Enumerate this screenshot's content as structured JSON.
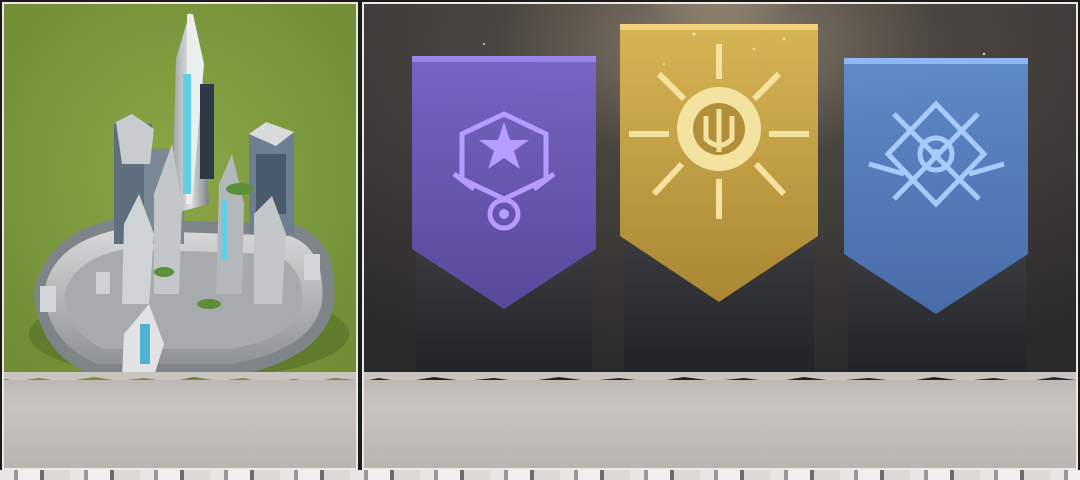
{
  "left_card": {
    "scene": "futuristic-citadel",
    "colors": {
      "grass": "#7f9a3b",
      "building": "#b9bcbf",
      "accent": "#5fd0ea"
    }
  },
  "right_card": {
    "banners": [
      {
        "icon": "star-crest-icon",
        "color": "#8f7bd6",
        "glow": "#b79cff"
      },
      {
        "icon": "trident-sun-icon",
        "color": "#d8b54e",
        "glow": "#ffe59a"
      },
      {
        "icon": "gear-swords-icon",
        "color": "#6f9ee0",
        "glow": "#a8ccff"
      }
    ]
  }
}
